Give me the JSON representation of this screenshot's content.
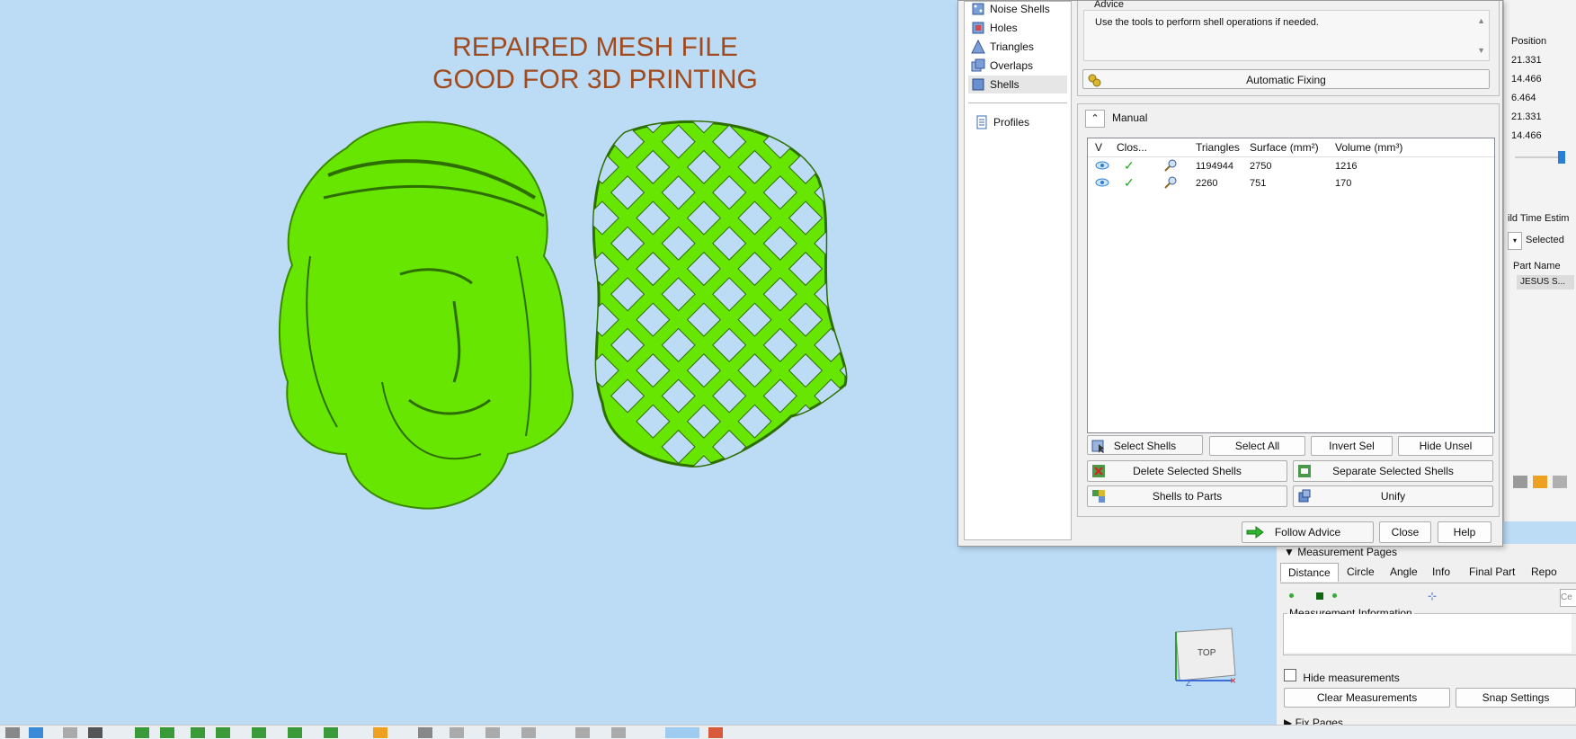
{
  "viewport": {
    "title_line1": "REPAIRED MESH FILE",
    "title_line2": "GOOD FOR 3D PRINTING",
    "model_color": "#66e600",
    "background_color": "#bcdcf6",
    "nav_cube_label": "TOP",
    "axis_z": "Z"
  },
  "nav": {
    "items": [
      {
        "label": "Noise Shells",
        "icon": "noise-shells-icon"
      },
      {
        "label": "Holes",
        "icon": "holes-icon"
      },
      {
        "label": "Triangles",
        "icon": "triangles-icon"
      },
      {
        "label": "Overlaps",
        "icon": "overlaps-icon"
      },
      {
        "label": "Shells",
        "icon": "shells-icon",
        "selected": true
      }
    ],
    "profiles": "Profiles"
  },
  "advice": {
    "title": "Advice",
    "text": "Use the tools to perform shell operations if needed.",
    "auto_fix": "Automatic Fixing"
  },
  "manual": {
    "title": "Manual",
    "columns": [
      "V",
      "Clos...",
      "",
      "Triangles",
      "Surface (mm²)",
      "Volume (mm³)"
    ],
    "rows": [
      {
        "triangles": "1194944",
        "surface": "2750",
        "volume": "1216"
      },
      {
        "triangles": "2260",
        "surface": "751",
        "volume": "170"
      }
    ],
    "buttons": {
      "select_shells": "Select Shells",
      "select_all": "Select All",
      "invert_sel": "Invert Sel",
      "hide_unsel": "Hide Unsel",
      "delete_selected": "Delete Selected Shells",
      "separate_selected": "Separate Selected Shells",
      "shells_to_parts": "Shells to Parts",
      "unify": "Unify"
    }
  },
  "footer": {
    "follow_advice": "Follow Advice",
    "close": "Close",
    "help": "Help"
  },
  "right_panel": {
    "position_header": "Position",
    "positions": [
      "21.331",
      "14.466",
      "6.464",
      "21.331",
      "14.466"
    ],
    "build_time": "ild Time Estim",
    "selected": "Selected",
    "part_name_header": "Part Name",
    "part_name": "JESUS S..."
  },
  "measurement": {
    "title": "Measurement Pages",
    "tabs": [
      "Distance",
      "Circle",
      "Angle",
      "Info",
      "Final Part",
      "Repo"
    ],
    "info_label": "Measurement Information",
    "hide_measurements": "Hide measurements",
    "clear": "Clear Measurements",
    "snap": "Snap Settings",
    "fix_pages": "Fix Pages",
    "field_placeholder": "Ce"
  }
}
